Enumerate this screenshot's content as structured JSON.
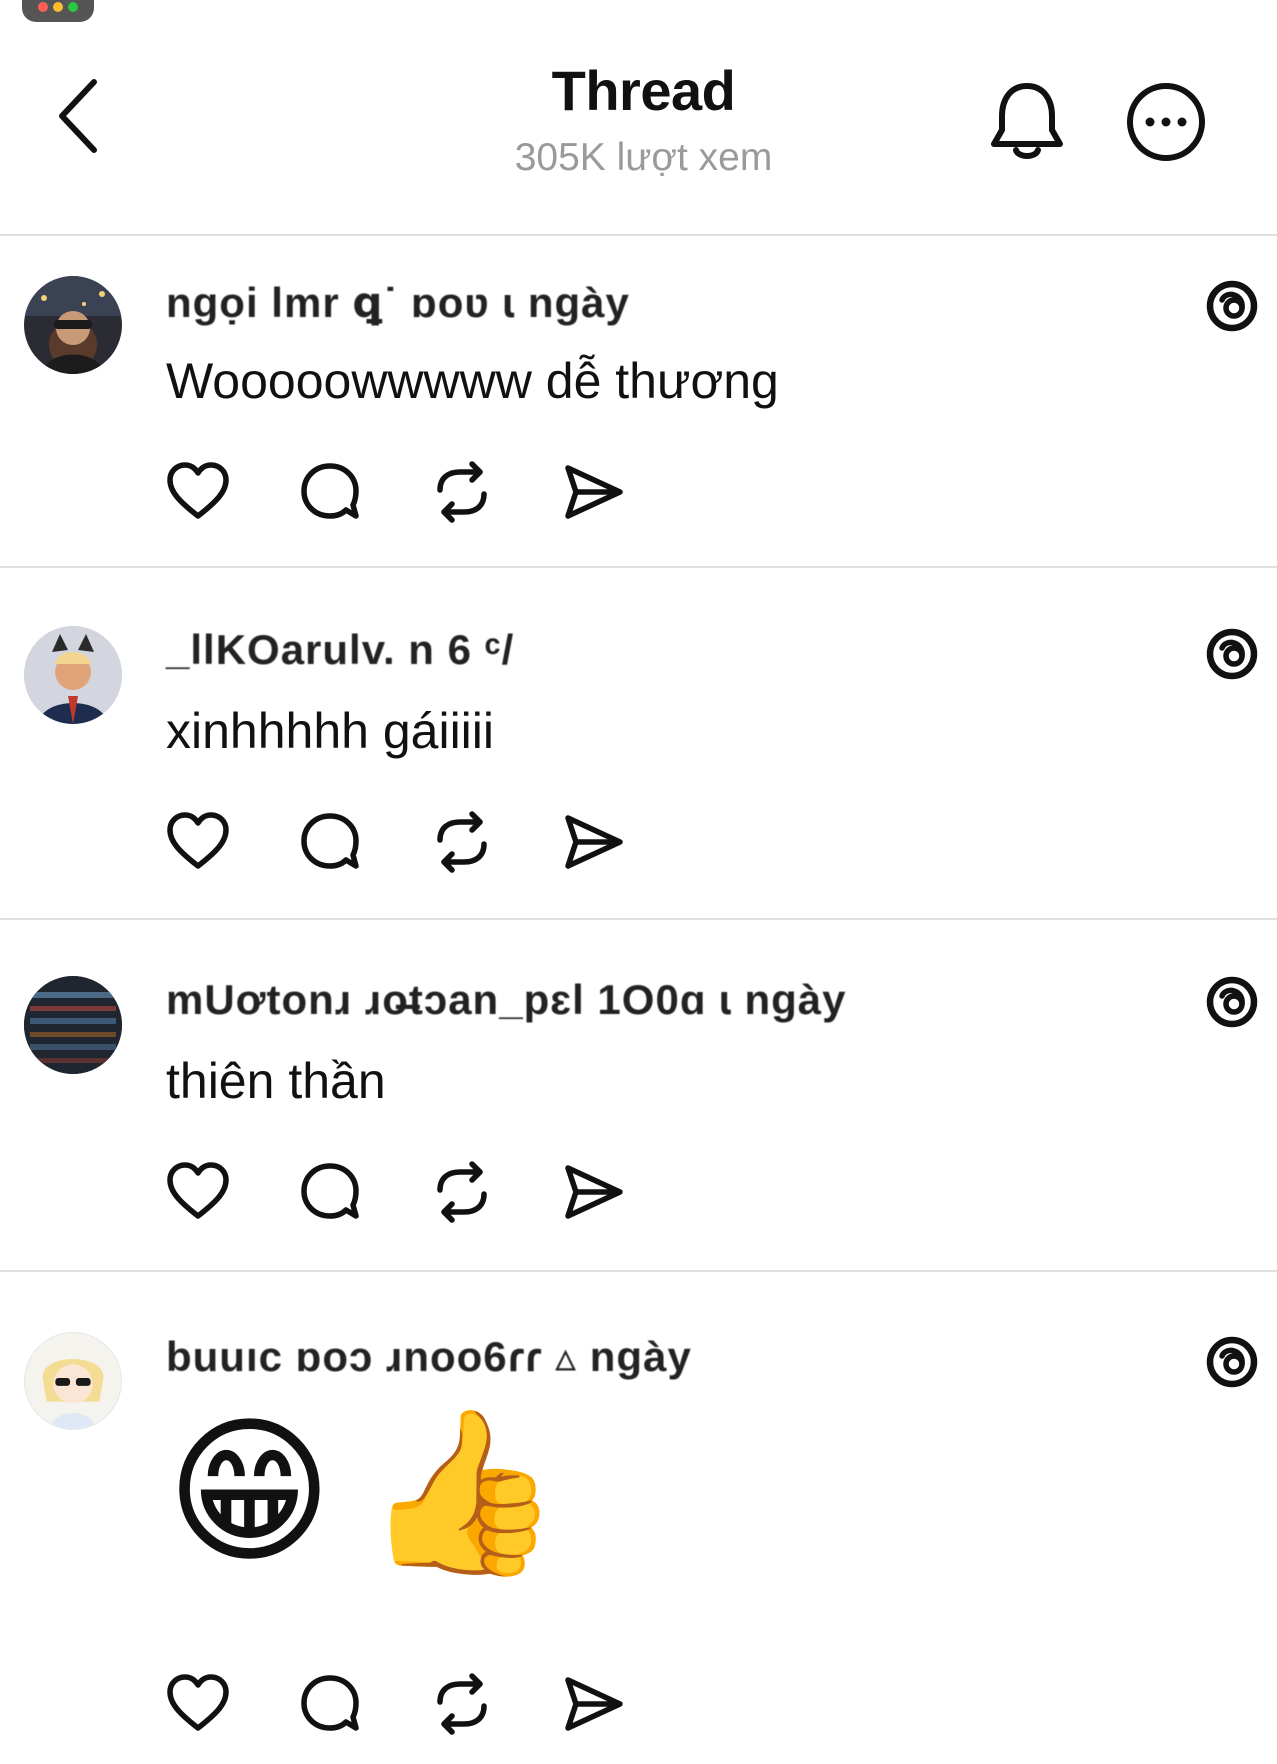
{
  "header": {
    "title": "Thread",
    "views": "305K lượt xem",
    "back_icon": "chevron-left-icon",
    "bell_icon": "bell-icon",
    "more_icon": "more-horizontal-icon"
  },
  "comments": [
    {
      "username": "ngọi lmr   ꝗ˙ ɒoʋ ɩ ngày",
      "text": "Wooooowwwww dễ thương",
      "avatar_icon": "user-avatar-photo"
    },
    {
      "username": "_llKOarulv.     n     6 ᶜ/",
      "text": "xinhhhhh gáiiiii",
      "avatar_icon": "user-avatar-photo"
    },
    {
      "username": "mUơtonɹ ɹo̶tɔan_pɛl 1O0ɑ ɩ ngày",
      "text": "thiên thần",
      "avatar_icon": "user-avatar-photo"
    },
    {
      "username": "buuıc ɒoɔ ɹnoo6ɾɾ ▵ ngày",
      "text": "",
      "emojis": [
        "😁",
        "👍"
      ],
      "avatar_icon": "user-avatar-cartoon"
    }
  ],
  "icons": {
    "like": "heart-icon",
    "reply": "comment-icon",
    "repost": "repost-icon",
    "share": "send-icon",
    "threads": "threads-logo-icon"
  },
  "colors": {
    "text": "#111111",
    "muted": "#9a9a9a",
    "divider": "#e0e0e0"
  }
}
